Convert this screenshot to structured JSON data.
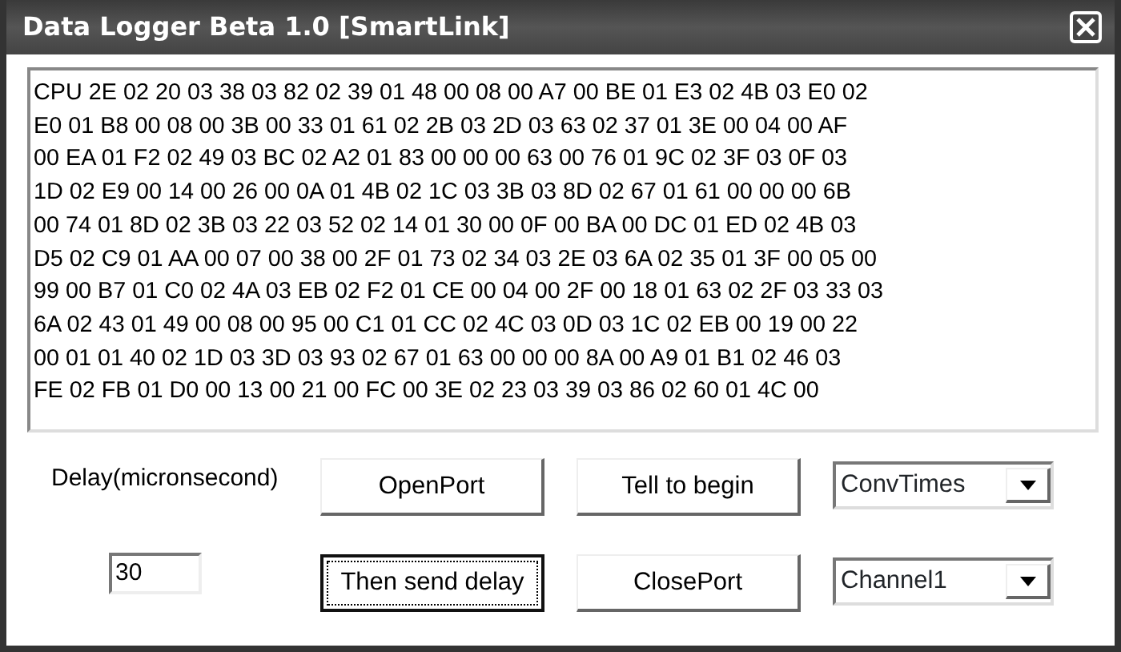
{
  "window": {
    "title": "Data Logger Beta 1.0 [SmartLink]"
  },
  "log": {
    "lines": [
      "CPU 2E 02 20 03 38 03 82 02 39 01 48 00 08 00 A7 00 BE 01 E3 02 4B 03 E0 02",
      "E0 01 B8 00 08 00 3B 00 33 01 61 02 2B 03 2D 03 63 02 37 01 3E 00 04 00 AF",
      "00 EA 01 F2 02 49 03 BC 02 A2 01 83 00 00 00 63 00 76 01 9C 02 3F 03 0F 03",
      "1D 02 E9 00 14 00 26 00 0A 01 4B 02 1C 03 3B 03 8D 02 67 01 61 00 00 00 6B",
      "00 74 01 8D 02 3B 03 22 03 52 02 14 01 30 00 0F 00 BA 00 DC 01 ED 02 4B 03",
      "D5 02 C9 01 AA 00 07 00 38 00 2F 01 73 02 34 03 2E 03 6A 02 35 01 3F 00 05 00",
      "99 00 B7 01 C0 02 4A 03 EB 02 F2 01 CE 00 04 00 2F 00 18 01 63 02 2F 03 33 03",
      "6A 02 43 01 49 00 08 00 95 00 C1 01 CC 02 4C 03 0D 03 1C 02 EB 00 19 00 22",
      "00 01 01 40 02 1D 03 3D 03 93 02 67 01 63 00 00 00 8A 00 A9 01 B1 02 46 03",
      "FE 02 FB 01 D0 00 13 00 21 00 FC 00 3E 02 23 03 39 03 86 02 60 01 4C 00"
    ]
  },
  "delay": {
    "label": "Delay(micronsecond)",
    "value": "30"
  },
  "buttons": [
    {
      "label": "OpenPort",
      "focused": false
    },
    {
      "label": "Tell to begin",
      "focused": false
    },
    {
      "label": "Then send delay",
      "focused": true
    },
    {
      "label": "ClosePort",
      "focused": false
    }
  ],
  "dropdowns": [
    {
      "value": "ConvTimes"
    },
    {
      "value": "Channel1"
    }
  ]
}
